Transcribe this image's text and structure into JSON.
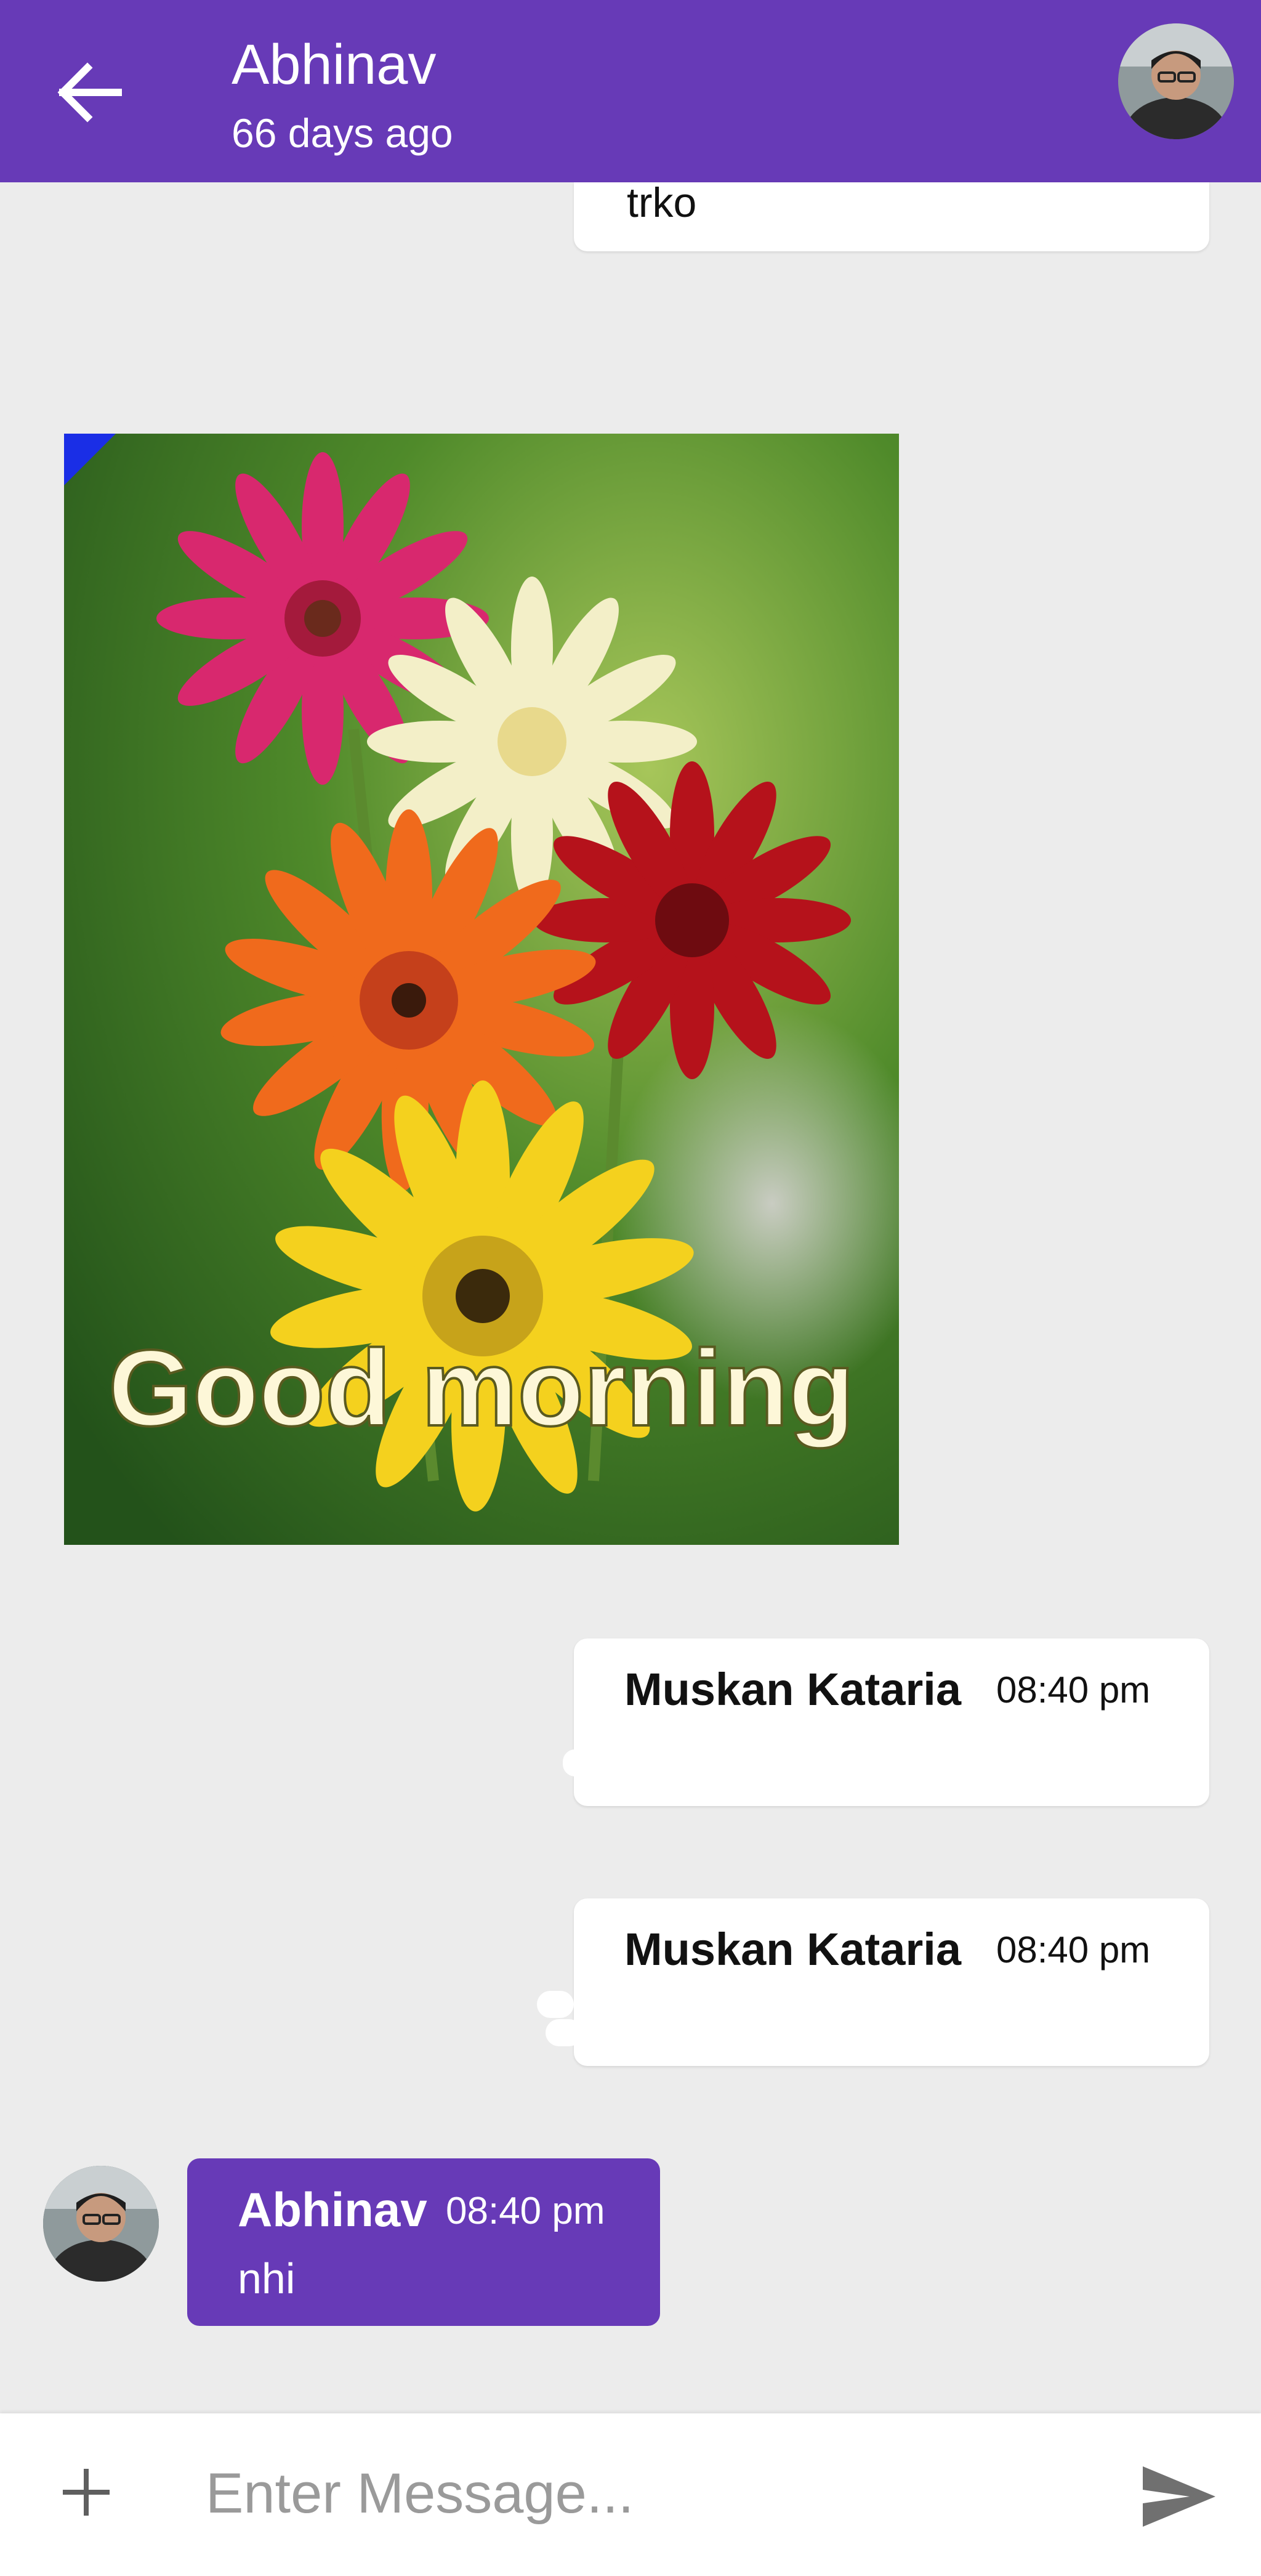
{
  "header": {
    "title": "Abhinav",
    "subtitle": "66 days ago",
    "back_icon": "arrow-back-icon",
    "avatar": "contact-avatar"
  },
  "messages": [
    {
      "type": "text",
      "direction": "sent",
      "text": "trko"
    },
    {
      "type": "image",
      "direction": "received",
      "image_text": "Good morning"
    },
    {
      "type": "text",
      "direction": "sent",
      "sender": "Muskan Kataria",
      "time": "08:40 pm"
    },
    {
      "type": "text",
      "direction": "sent",
      "sender": "Muskan Kataria",
      "time": "08:40 pm"
    },
    {
      "type": "text",
      "direction": "received",
      "sender": "Abhinav",
      "time": "08:40 pm",
      "text": "nhi"
    }
  ],
  "composer": {
    "placeholder": "Enter Message...",
    "attach_icon": "plus-icon",
    "send_icon": "send-icon"
  },
  "colors": {
    "primary": "#673ab7",
    "background": "#ececec",
    "bubble": "#ffffff"
  }
}
